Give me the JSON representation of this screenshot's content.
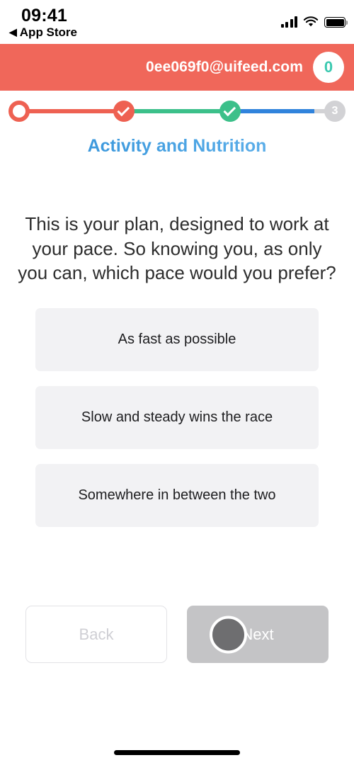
{
  "status_bar": {
    "time": "09:41",
    "back_link": "App Store",
    "back_arrow": "◀",
    "icons": [
      "cellular-signal-icon",
      "wifi-icon",
      "battery-icon"
    ]
  },
  "app_bar": {
    "email": "0ee069f0@uifeed.com",
    "badge_count": "0",
    "background_color": "#f0675a",
    "badge_text_color": "#3bc9b0"
  },
  "stepper": {
    "steps": [
      {
        "label": "",
        "state": "current-ring",
        "color": "#ee6152"
      },
      {
        "label": "",
        "state": "complete-check",
        "color": "#ee6152"
      },
      {
        "label": "",
        "state": "complete-check",
        "color": "#3cc08a"
      },
      {
        "label": "3",
        "state": "pending-number",
        "color": "#d2d2d5"
      }
    ],
    "connectors": [
      {
        "color": "#ee6152"
      },
      {
        "color": "#3cc08a"
      },
      {
        "color": "#3083dc"
      },
      {
        "color": "#d2d2d5"
      }
    ]
  },
  "section": {
    "title": "Activity and Nutrition",
    "title_gradient_from": "#2f8ed6",
    "title_gradient_to": "#6cb8ee"
  },
  "question": {
    "text": "This is your plan, designed to work at your pace. So knowing you, as only you can, which pace would you prefer?"
  },
  "options": [
    {
      "label": "As fast as possible"
    },
    {
      "label": "Slow and steady wins the race"
    },
    {
      "label": "Somewhere in between the two"
    }
  ],
  "footer": {
    "back_label": "Back",
    "next_label": "Next",
    "next_state": "loading-disabled",
    "next_background": "#c4c4c6",
    "spinner_color": "#6e6e70"
  }
}
